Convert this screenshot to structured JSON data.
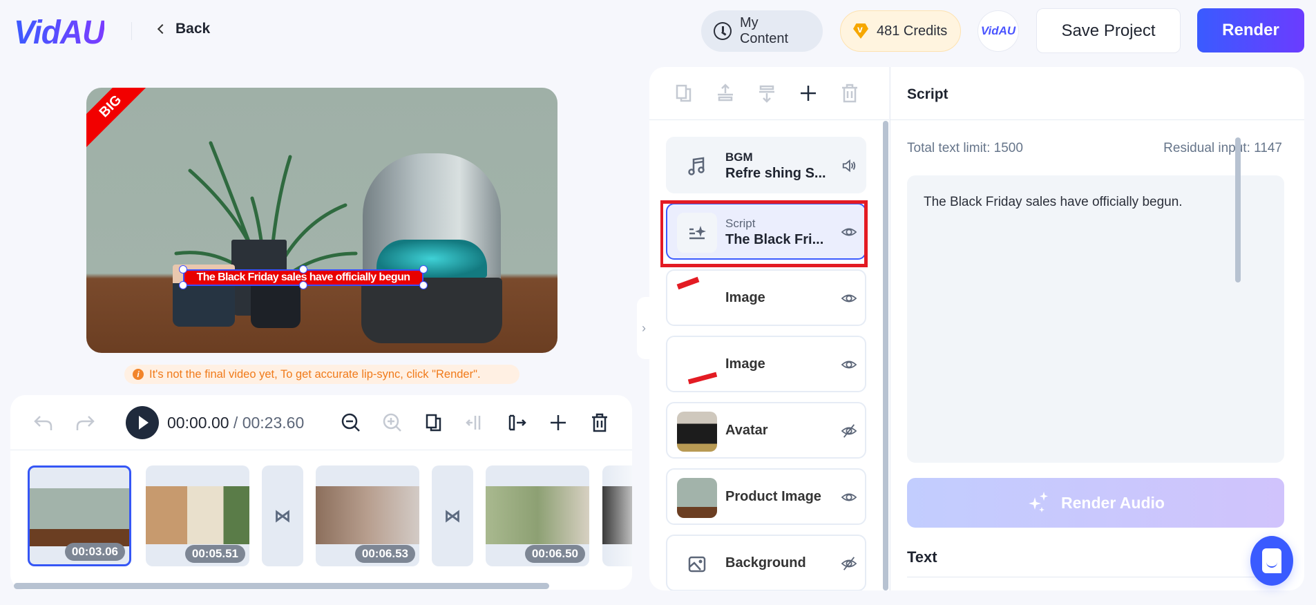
{
  "header": {
    "logo": "VidAU",
    "back_label": "Back",
    "my_content_label": "My Content",
    "credits_label": "481 Credits",
    "avatar_logo": "VidAU",
    "save_label": "Save Project",
    "render_label": "Render"
  },
  "preview": {
    "ribbon_text": "BIG",
    "caption": "The Black Friday sales have officially begun",
    "notice": "It's not the final video yet, To get accurate lip-sync, click \"Render\"."
  },
  "timeline": {
    "current_time": "00:00.00",
    "separator": " / ",
    "total_time": "00:23.60",
    "clips": [
      {
        "duration": "00:03.06",
        "selected": true
      },
      {
        "duration": "00:05.51",
        "selected": false
      },
      {
        "duration": "00:06.53",
        "selected": false
      },
      {
        "duration": "00:06.50",
        "selected": false
      }
    ],
    "icons": [
      "undo-icon",
      "redo-icon",
      "play-icon",
      "zoom-out-icon",
      "zoom-in-icon",
      "duplicate-icon",
      "split-left-icon",
      "split-right-icon",
      "add-icon",
      "delete-icon"
    ]
  },
  "layers": {
    "toolbar_icons": [
      "duplicate-icon",
      "move-up-icon",
      "move-down-icon",
      "add-icon",
      "delete-icon"
    ],
    "items": [
      {
        "type": "bgm",
        "label": "BGM",
        "title": "Refre shing S...",
        "icon": "music-icon",
        "action_icon": "volume-icon"
      },
      {
        "type": "script",
        "label": "Script",
        "title": "The Black Fri...",
        "icon": "script-sparkle-icon",
        "action_icon": "eye-icon",
        "active": true
      },
      {
        "type": "image",
        "title": "Image",
        "action_icon": "eye-icon"
      },
      {
        "type": "image",
        "title": "Image",
        "action_icon": "eye-icon"
      },
      {
        "type": "avatar",
        "title": "Avatar",
        "action_icon": "eye-off-icon"
      },
      {
        "type": "product",
        "title": "Product Image",
        "action_icon": "eye-icon"
      },
      {
        "type": "background",
        "title": "Background",
        "icon": "image-icon",
        "action_icon": "eye-off-icon"
      }
    ]
  },
  "script_panel": {
    "title": "Script",
    "total_limit_label": "Total text limit: 1500",
    "residual_label": "Residual input: 1147",
    "script_text": "The Black Friday sales have officially begun.",
    "render_audio_label": "Render Audio",
    "text_section_label": "Text"
  },
  "colors": {
    "accent": "#3a5bff",
    "accent_purple": "#6b3cff",
    "warning": "#f07a1a",
    "credits_gem": "#f6a700",
    "annotation_red": "#e31b23"
  }
}
